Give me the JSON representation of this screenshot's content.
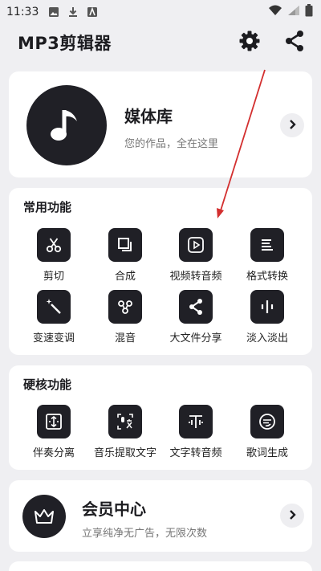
{
  "status_bar": {
    "time": "11:33",
    "icons": [
      "image-icon",
      "download-icon",
      "app-icon"
    ],
    "right_icons": [
      "wifi-icon",
      "signal-icon",
      "battery-icon"
    ]
  },
  "app_bar": {
    "title": "MP3剪辑器",
    "actions": [
      "settings-icon",
      "share-icon"
    ]
  },
  "media_library": {
    "title": "媒体库",
    "subtitle": "您的作品，全在这里",
    "icon": "music-note-icon"
  },
  "common_functions": {
    "title": "常用功能",
    "items": [
      {
        "label": "剪切",
        "icon": "scissors-icon"
      },
      {
        "label": "合成",
        "icon": "merge-icon"
      },
      {
        "label": "视频转音频",
        "icon": "video-play-icon"
      },
      {
        "label": "格式转换",
        "icon": "lines-icon"
      },
      {
        "label": "变速变调",
        "icon": "magic-wand-icon"
      },
      {
        "label": "混音",
        "icon": "mix-icon"
      },
      {
        "label": "大文件分享",
        "icon": "share-icon"
      },
      {
        "label": "淡入淡出",
        "icon": "waveform-icon"
      }
    ]
  },
  "hardcore_functions": {
    "title": "硬核功能",
    "items": [
      {
        "label": "伴奏分离",
        "icon": "separate-icon"
      },
      {
        "label": "音乐提取文字",
        "icon": "voice-to-text-icon"
      },
      {
        "label": "文字转音频",
        "icon": "text-to-audio-icon"
      },
      {
        "label": "歌词生成",
        "icon": "lyrics-icon"
      }
    ]
  },
  "vip_center": {
    "title": "会员中心",
    "subtitle": "立享纯净无广告，无限次数",
    "icon": "crown-icon"
  },
  "colors": {
    "background": "#efeff2",
    "card": "#ffffff",
    "icon_tile": "#202026",
    "annotation_arrow": "#d32f2f"
  }
}
